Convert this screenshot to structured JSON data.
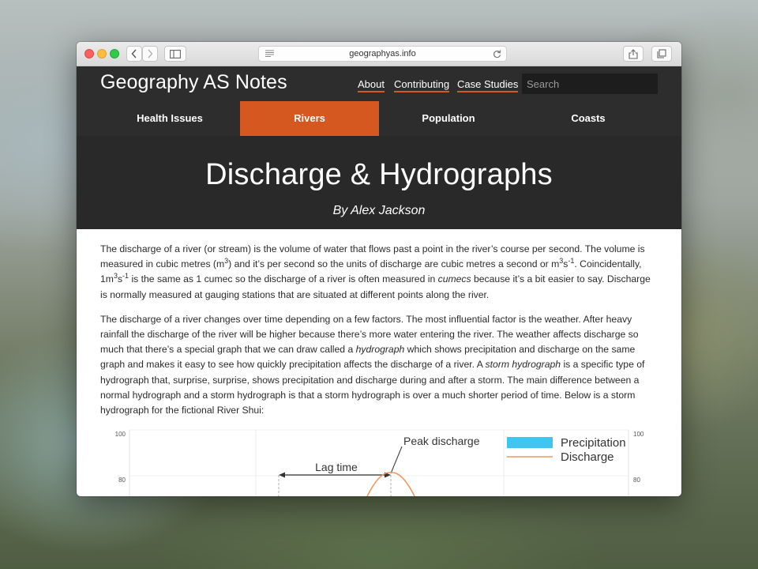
{
  "browser": {
    "url": "geographyas.info",
    "icons": [
      "back-icon",
      "forward-icon",
      "sidebar-icon",
      "reader-icon",
      "reload-icon",
      "share-icon",
      "tabs-icon"
    ]
  },
  "site": {
    "title": "Geography AS Notes",
    "top_links": [
      "About",
      "Contributing",
      "Case Studies"
    ],
    "search_placeholder": "Search",
    "accent_color": "#d4581f",
    "nav": [
      {
        "label": "Health Issues",
        "active": false
      },
      {
        "label": "Rivers",
        "active": true
      },
      {
        "label": "Population",
        "active": false
      },
      {
        "label": "Coasts",
        "active": false
      }
    ]
  },
  "article": {
    "title": "Discharge & Hydrographs",
    "author": "By Alex Jackson",
    "p1": {
      "a": "The discharge of a river (or stream) is the volume of water that flows past a point in the river’s course per second. The volume is measured in cubic metres (m",
      "b": "3",
      "c": ") and it’s per second so the units of discharge are cubic metres a second or m",
      "d": "3",
      "e": "s",
      "f": "-1",
      "g": ". Coincidentally, 1m",
      "h": "3",
      "i": "s",
      "j": "-1",
      "k": " is the same as 1 cumec so the discharge of a river is often measured in ",
      "l": "cumecs",
      "m": " because it’s a bit easier to say. Discharge is normally measured at gauging stations that are situated at different points along the river."
    },
    "p2": {
      "a": "The discharge of a river changes over time depending on a few factors. The most influential factor is the weather. After heavy rainfall the discharge of the river will be higher because there’s more water entering the river. The weather affects discharge so much that there’s a special graph that we can draw called a ",
      "b": "hydrograph",
      "c": " which shows precipitation and discharge on the same graph and makes it easy to see how quickly precipitation affects the discharge of a river. A ",
      "d": "storm hydrograph",
      "e": " is a specific type of hydrograph that, surprise, surprise, shows precipitation and discharge during and after a storm. The main difference between a normal hydrograph and a storm hydrograph is that a storm hydrograph is over a much shorter period of time. Below is a storm hydrograph for the fictional River Shui:"
    }
  },
  "chart_data": {
    "type": "line",
    "y_ticks_left": [
      "100",
      "80"
    ],
    "y_ticks_right": [
      "100",
      "80"
    ],
    "annotations": [
      "Peak discharge",
      "Lag time"
    ],
    "legend": [
      {
        "label": "Precipitation",
        "color": "#3ec6f0"
      },
      {
        "label": "Discharge",
        "color": "#f0975e"
      }
    ],
    "legend_position": "top-right",
    "visible_y_range": [
      80,
      100
    ]
  }
}
